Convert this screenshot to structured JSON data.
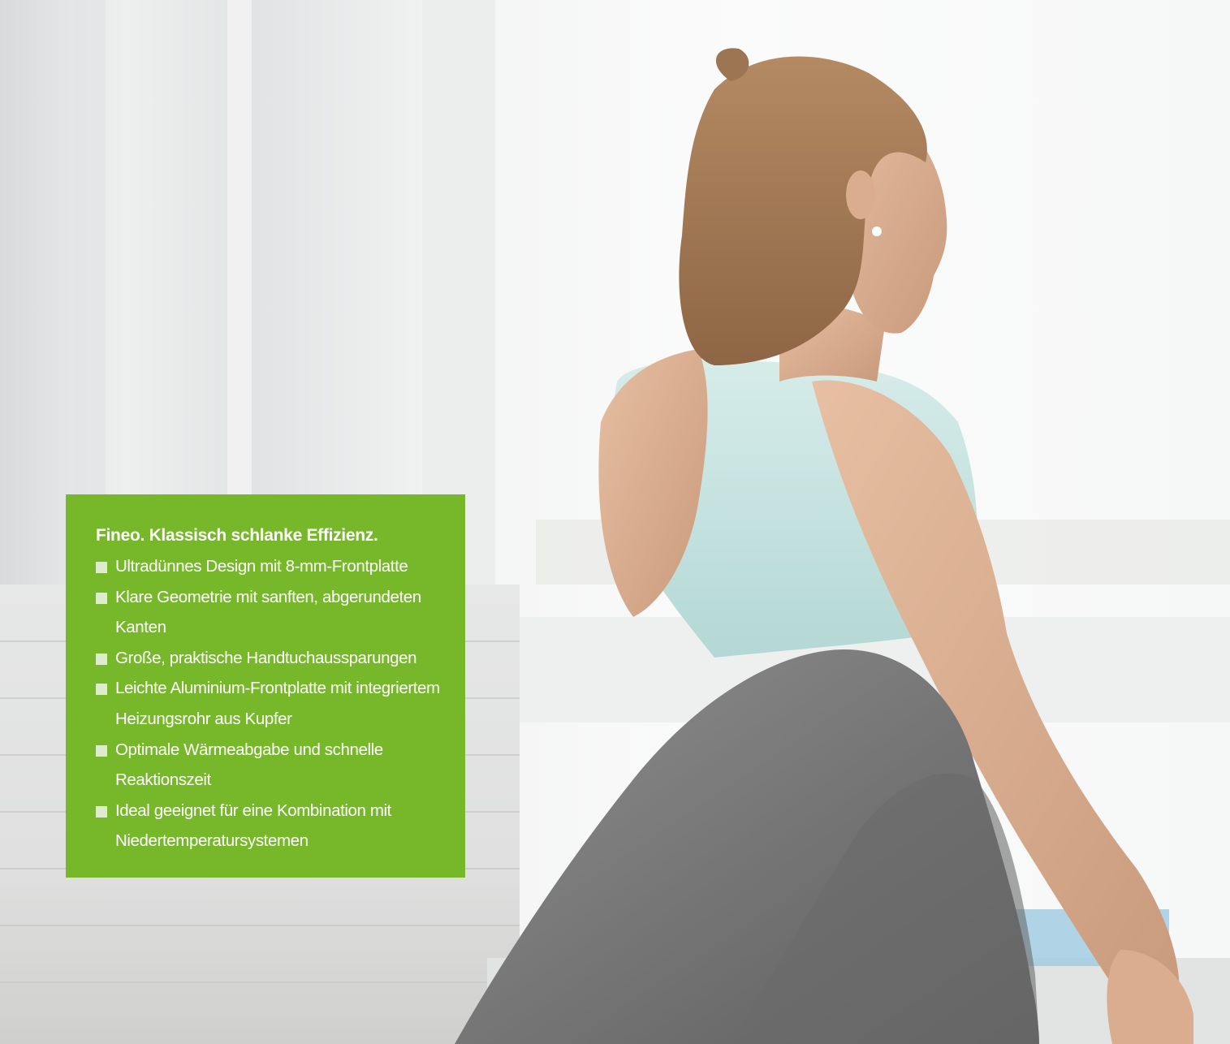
{
  "colors": {
    "panel_background": "#76b82a",
    "panel_text": "#ffffff",
    "bullet": "#dceccc"
  },
  "photo": {
    "subject": "woman-stretching-yoga-pose"
  },
  "panel": {
    "title": "Fineo. Klassisch schlanke Effizienz.",
    "features": [
      "Ultradünnes Design mit 8-mm-Frontplatte",
      "Klare Geometrie mit sanften, abgerundeten Kanten",
      "Große, praktische Handtuchaussparungen",
      "Leichte Aluminium-Frontplatte mit integriertem Heizungsrohr aus Kupfer",
      "Optimale Wärmeabgabe und schnelle Reaktionszeit",
      "Ideal geeignet für eine Kombination mit Niedertemperatursystemen"
    ]
  }
}
